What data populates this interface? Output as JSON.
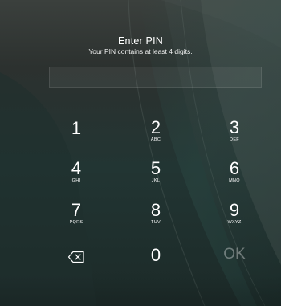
{
  "header": {
    "title": "Enter PIN",
    "subtitle": "Your PIN contains at least 4 digits."
  },
  "pin_field": {
    "value": ""
  },
  "keypad": {
    "keys": [
      {
        "digit": "1",
        "letters": ""
      },
      {
        "digit": "2",
        "letters": "ABC"
      },
      {
        "digit": "3",
        "letters": "DEF"
      },
      {
        "digit": "4",
        "letters": "GHI"
      },
      {
        "digit": "5",
        "letters": "JKL"
      },
      {
        "digit": "6",
        "letters": "MNO"
      },
      {
        "digit": "7",
        "letters": "PQRS"
      },
      {
        "digit": "8",
        "letters": "TUV"
      },
      {
        "digit": "9",
        "letters": "WXYZ"
      },
      {
        "digit": "0",
        "letters": ""
      }
    ],
    "ok_label": "OK",
    "backspace_icon": "backspace-icon"
  },
  "colors": {
    "text": "#ffffff",
    "background_top": "#3b403d",
    "background_bottom": "#1c2a28"
  }
}
